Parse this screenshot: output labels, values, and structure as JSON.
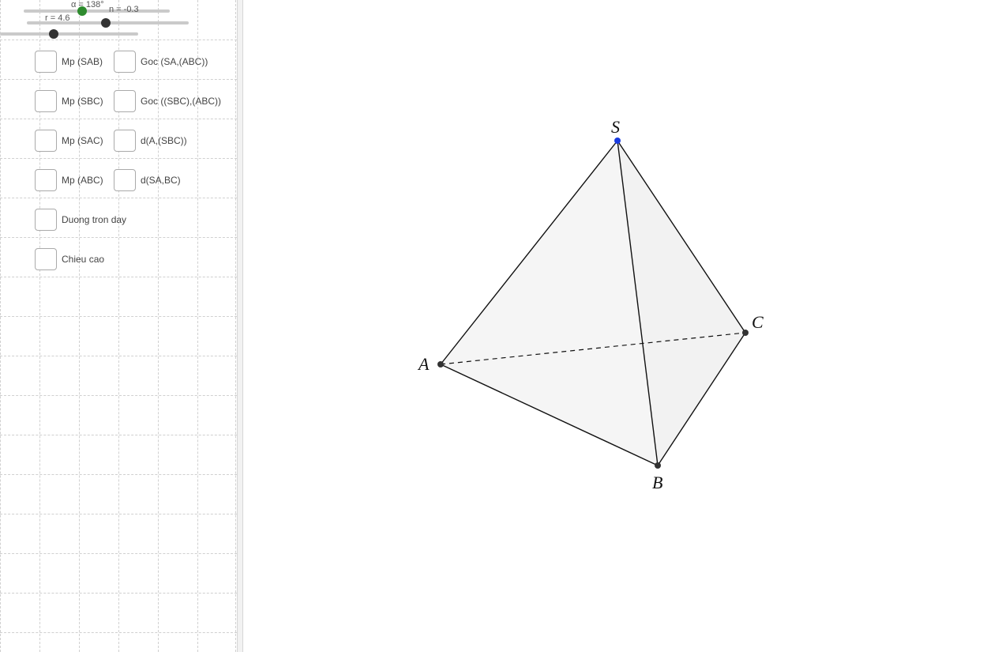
{
  "sliders": {
    "alpha": {
      "label": "α = 138°"
    },
    "n": {
      "label": "n = -0.3"
    },
    "r": {
      "label": "r = 4.6"
    }
  },
  "checkboxes": {
    "mp_sab": "Mp (SAB)",
    "mp_sbc": "Mp (SBC)",
    "mp_sac": "Mp (SAC)",
    "mp_abc": "Mp (ABC)",
    "duong_tron_day": "Duong tron day",
    "chieu_cao": "Chieu cao",
    "goc_sa_abc": "Goc (SA,(ABC))",
    "goc_sbc_abc": "Goc ((SBC),(ABC))",
    "d_a_sbc": "d(A,(SBC))",
    "d_sa_bc": "d(SA,BC)"
  },
  "vertices": {
    "S": "S",
    "A": "A",
    "B": "B",
    "C": "C"
  }
}
